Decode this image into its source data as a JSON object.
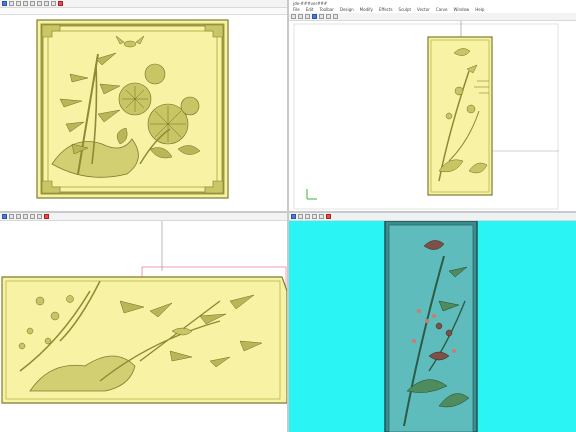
{
  "window_top_right": {
    "title": "jde-###ver###",
    "menu": [
      "File",
      "Edit",
      "Toolbar",
      "Design",
      "Modify",
      "Effects",
      "Sculpt",
      "Vector",
      "Carve",
      "Window",
      "Help"
    ]
  },
  "colors": {
    "relief": "#f8f2a4",
    "relief_dark": "#7c7c2e",
    "relief_mid": "#c9c666",
    "cyan_bg": "#2af4f4",
    "teal_relief": "#4aa6a6",
    "toolbar_bg": "#f3f3f3",
    "guide_red": "#e85a7a",
    "guide_blue": "#3c6bd6"
  },
  "icons": {
    "tool": "toolbar-button-icon",
    "axis": "axis-gizmo-icon"
  }
}
